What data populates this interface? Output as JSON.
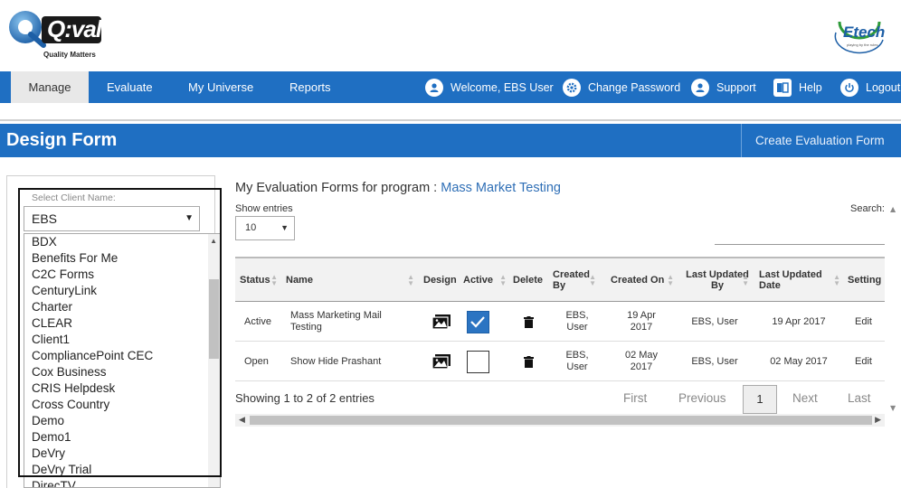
{
  "header": {
    "logo_text": "Q:val",
    "logo_tagline": "Quality Matters",
    "partner_logo": "Etech",
    "partner_tagline": "playing by the rules"
  },
  "nav": {
    "items": [
      {
        "label": "Manage",
        "active": true
      },
      {
        "label": "Evaluate",
        "active": false
      },
      {
        "label": "My Universe",
        "active": false
      },
      {
        "label": "Reports",
        "active": false
      }
    ],
    "right": [
      {
        "label": "Welcome, EBS User",
        "icon": "user-icon"
      },
      {
        "label": "Change Password",
        "icon": "gear-icon"
      },
      {
        "label": "Support",
        "icon": "support-icon"
      },
      {
        "label": "Help",
        "icon": "help-book-icon"
      },
      {
        "label": "Logout",
        "icon": "power-icon"
      }
    ]
  },
  "titlebar": {
    "title": "Design Form",
    "action": "Create Evaluation Form"
  },
  "client": {
    "label": "Select Client Name:",
    "selected": "EBS",
    "options": [
      "BDX",
      "Benefits For Me",
      "C2C Forms",
      "CenturyLink",
      "Charter",
      "CLEAR",
      "Client1",
      "CompliancePoint CEC",
      "Cox Business",
      "CRIS Helpdesk",
      "Cross Country",
      "Demo",
      "Demo1",
      "DeVry",
      "DeVry Trial",
      "DirecTV"
    ]
  },
  "main": {
    "program_prefix": "My Evaluation Forms for program :",
    "program_name": "Mass Market Testing",
    "show_entries_label": "Show entries",
    "entries_value": "10",
    "search_label": "Search:",
    "columns": [
      "Status",
      "Name",
      "Design",
      "Active",
      "Delete",
      "Created By",
      "Created On",
      "Last Updated By",
      "Last Updated Date",
      "Setting"
    ],
    "rows": [
      {
        "status": "Active",
        "name": "Mass Marketing Mail Testing",
        "active": true,
        "created_by": "EBS, User",
        "created_on": "19 Apr 2017",
        "updated_by": "EBS, User",
        "updated_date": "19 Apr 2017",
        "setting": "Edit"
      },
      {
        "status": "Open",
        "name": "Show Hide Prashant",
        "active": false,
        "created_by": "EBS, User",
        "created_on": "02 May 2017",
        "updated_by": "EBS, User",
        "updated_date": "02 May 2017",
        "setting": "Edit"
      }
    ],
    "showing": "Showing 1 to 2 of 2 entries",
    "pager": {
      "first": "First",
      "previous": "Previous",
      "current": "1",
      "next": "Next",
      "last": "Last"
    }
  },
  "colors": {
    "brand_blue": "#1f6fc2",
    "link_blue": "#2f6fb6",
    "check_blue": "#2b74c2"
  }
}
